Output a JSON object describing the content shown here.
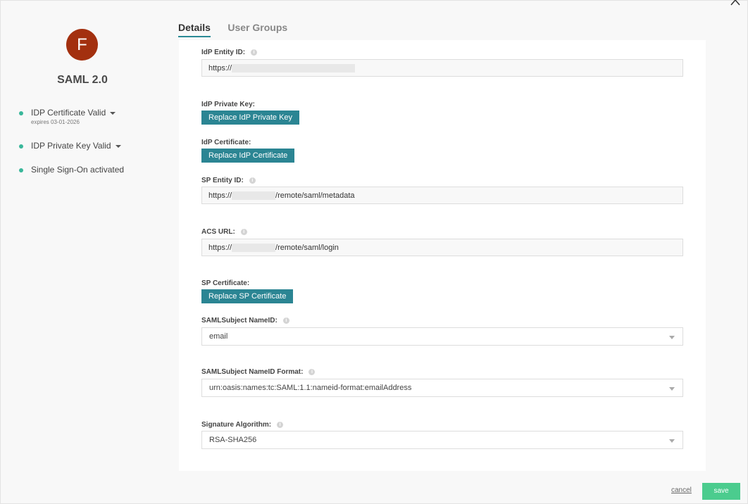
{
  "sidebar": {
    "avatar_letter": "F",
    "title": "SAML 2.0",
    "status_items": [
      {
        "label": "IDP Certificate Valid",
        "sub": "expires 03-01-2026"
      },
      {
        "label": "IDP Private Key Valid"
      },
      {
        "label": "Single Sign-On activated"
      }
    ]
  },
  "tabs": [
    {
      "label": "Details",
      "active": true
    },
    {
      "label": "User Groups",
      "active": false
    }
  ],
  "form": {
    "idp_entity_id": {
      "label": "IdP Entity ID:",
      "value": "https://"
    },
    "idp_private_key": {
      "label": "IdP Private Key:",
      "button": "Replace IdP Private Key"
    },
    "idp_certificate": {
      "label": "IdP Certificate:",
      "button": "Replace IdP Certificate"
    },
    "sp_entity_id": {
      "label": "SP Entity ID:",
      "value_prefix": "https://",
      "value_suffix": "/remote/saml/metadata"
    },
    "acs_url": {
      "label": "ACS URL:",
      "value_prefix": "https://",
      "value_suffix": "/remote/saml/login"
    },
    "sp_certificate": {
      "label": "SP Certificate:",
      "button": "Replace SP Certificate"
    },
    "saml_subject_nameid": {
      "label": "SAMLSubject NameID:",
      "value": "email"
    },
    "saml_subject_nameid_format": {
      "label": "SAMLSubject NameID Format:",
      "value": "urn:oasis:names:tc:SAML:1.1:nameid-format:emailAddress"
    },
    "signature_algorithm": {
      "label": "Signature Algorithm:",
      "value": "RSA-SHA256"
    }
  },
  "footer": {
    "cancel_label": "cancel",
    "save_label": "save"
  },
  "colors": {
    "accent": "#2b8593",
    "save": "#4bcc8e",
    "status_dot": "#39b79a",
    "avatar": "#a3300f"
  }
}
